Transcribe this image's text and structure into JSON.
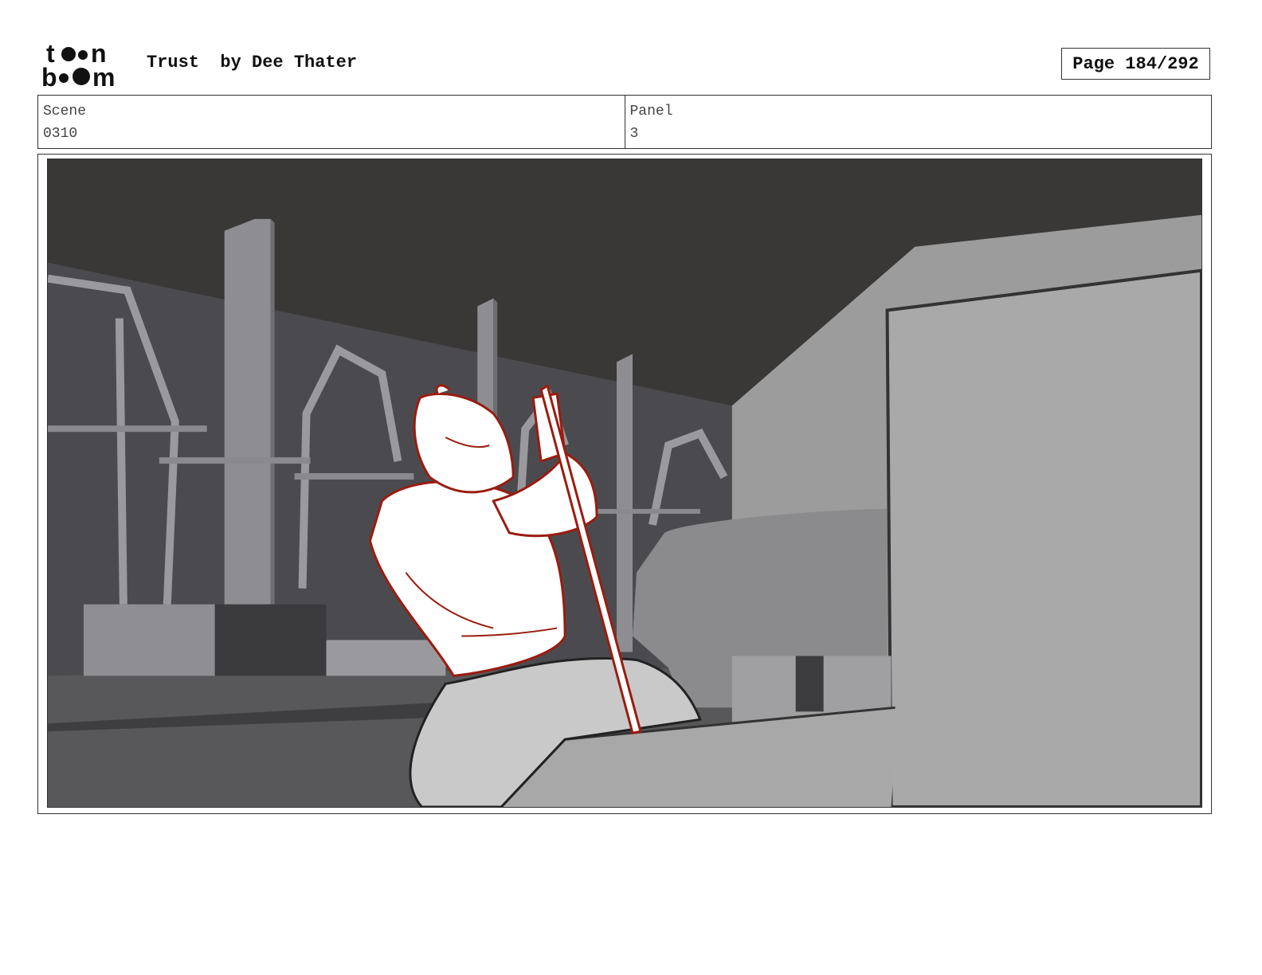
{
  "header": {
    "logo_text": "toon boom",
    "title": "Trust  by Dee Thater",
    "page_label": "Page 184/292"
  },
  "info": {
    "scene_label": "Scene",
    "scene_value": "0310",
    "panel_label": "Panel",
    "panel_value": "3"
  },
  "panel_image": {
    "description_icon": "storyboard-panel-image",
    "sketch_color": "#9a1c10"
  }
}
